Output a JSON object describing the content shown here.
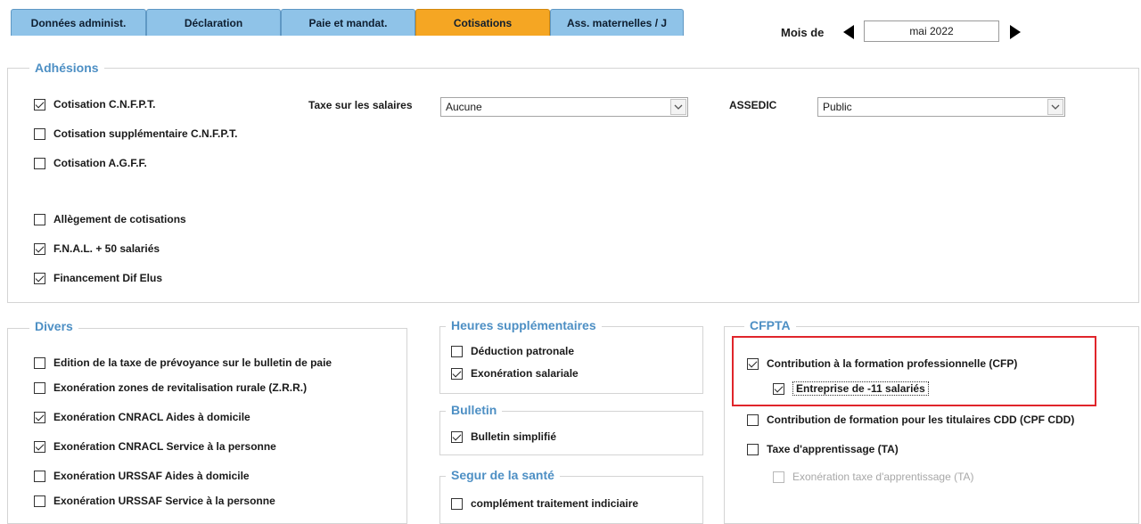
{
  "tabs": [
    {
      "label": "Données administ.",
      "active": false
    },
    {
      "label": "Déclaration",
      "active": false
    },
    {
      "label": "Paie et mandat.",
      "active": false
    },
    {
      "label": "Cotisations",
      "active": true
    },
    {
      "label": "Ass. maternelles / J",
      "active": false
    }
  ],
  "month": {
    "label": "Mois de",
    "value": "mai 2022"
  },
  "adhesions": {
    "title": "Adhésions",
    "items": [
      {
        "label": "Cotisation C.N.F.P.T.",
        "checked": true
      },
      {
        "label": "Cotisation supplémentaire C.N.F.P.T.",
        "checked": false
      },
      {
        "label": "Cotisation A.G.F.F.",
        "checked": false
      },
      {
        "label": "Allègement de cotisations",
        "checked": false
      },
      {
        "label": "F.N.A.L. + 50 salariés",
        "checked": true
      },
      {
        "label": "Financement Dif Elus",
        "checked": true
      }
    ],
    "taxe_label": "Taxe sur les salaires",
    "taxe_value": "Aucune",
    "assedic_label": "ASSEDIC",
    "assedic_value": "Public"
  },
  "divers": {
    "title": "Divers",
    "items": [
      {
        "label": "Edition de la taxe de prévoyance sur le bulletin de paie",
        "checked": false
      },
      {
        "label": "Exonération zones de revitalisation rurale (Z.R.R.)",
        "checked": false
      },
      {
        "label": "Exonération CNRACL Aides à domicile",
        "checked": true
      },
      {
        "label": "Exonération CNRACL Service à la personne",
        "checked": true
      },
      {
        "label": "Exonération URSSAF Aides à domicile",
        "checked": false
      },
      {
        "label": "Exonération URSSAF Service à la personne",
        "checked": false
      }
    ]
  },
  "heures": {
    "title": "Heures supplémentaires",
    "items": [
      {
        "label": "Déduction patronale",
        "checked": false
      },
      {
        "label": "Exonération salariale",
        "checked": true
      }
    ]
  },
  "bulletin": {
    "title": "Bulletin",
    "items": [
      {
        "label": "Bulletin simplifié",
        "checked": true
      }
    ]
  },
  "segur": {
    "title": "Segur de la santé",
    "items": [
      {
        "label": "complément traitement indiciaire",
        "checked": false
      }
    ]
  },
  "cfpta": {
    "title": "CFPTA",
    "items": [
      {
        "label": "Contribution à la formation professionnelle (CFP)",
        "checked": true
      },
      {
        "label": "Entreprise de -11 salariés",
        "checked": true
      },
      {
        "label": "Contribution de formation pour les titulaires CDD (CPF CDD)",
        "checked": false
      },
      {
        "label": "Taxe d'apprentissage (TA)",
        "checked": false
      },
      {
        "label": "Exonération taxe d'apprentissage (TA)",
        "checked": false,
        "disabled": true
      }
    ]
  },
  "colors": {
    "tab": "#8fc3e8",
    "tab_active": "#f5a623",
    "group_title": "#4d8fc4",
    "highlight": "#e0252b"
  }
}
